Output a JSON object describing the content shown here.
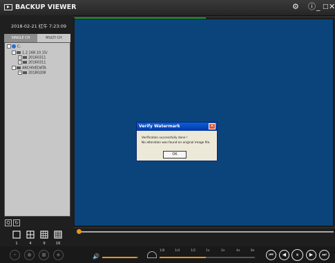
{
  "window": {
    "title": "BACKUP VIEWER",
    "buttons": {
      "settings": "⚙",
      "info": "ⓘ",
      "minimize": "_",
      "maximize": "□",
      "close": "✕"
    }
  },
  "left_panel": {
    "datetime": "2018-02-21 红午 7:23:09",
    "tabs": {
      "single": "SINGLE CH",
      "multi": "MULTI CH"
    },
    "tree": {
      "root": "C:",
      "nodes": [
        "1.2.168.10.15/",
        "20160311",
        "20160311",
        "ARCHIVEDATA",
        "20180208"
      ]
    },
    "small_buttons": {
      "search": "Q",
      "refresh": "↻"
    }
  },
  "layouts": [
    {
      "label": "1",
      "icon": "single-view-icon"
    },
    {
      "label": "4",
      "icon": "quad-view-icon"
    },
    {
      "label": "9",
      "icon": "nine-view-icon"
    },
    {
      "label": "16",
      "icon": "sixteen-view-icon"
    }
  ],
  "dialog": {
    "title": "Verify Watermark",
    "line1": "Verification successfully done !",
    "line2": "No alteration was found on original image file.",
    "ok": "OK"
  },
  "playback": {
    "speed_labels": [
      "1/8",
      "1/4",
      "1/2",
      "1x",
      "2x",
      "4x",
      "8x"
    ],
    "volume_level": 0.96,
    "speed_level": 0.5,
    "progress": 0.0,
    "buttons": {
      "previous": "⏮",
      "rewind": "◀",
      "pause": "⏸",
      "play": "▶",
      "next": "⏭"
    }
  },
  "colors": {
    "accent": "#e8961c",
    "video_bg": "#0b447b",
    "dialog_title": "#0437a8"
  }
}
